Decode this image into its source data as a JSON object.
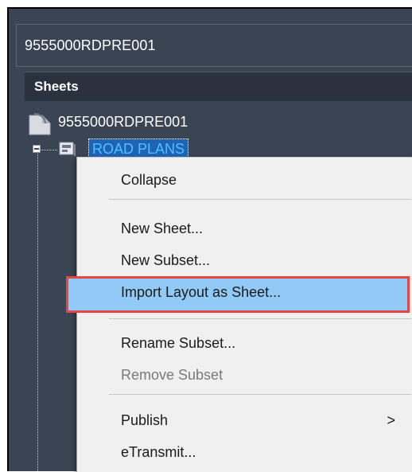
{
  "title_field": {
    "value": "9555000RDPRE001"
  },
  "panel": {
    "header": "Sheets"
  },
  "tree": {
    "root_label": "9555000RDPRE001",
    "subset_label": "ROAD PLANS"
  },
  "context_menu": {
    "items": [
      {
        "label": "Collapse",
        "enabled": true
      },
      {
        "label": "New Sheet...",
        "enabled": true
      },
      {
        "label": "New Subset...",
        "enabled": true
      },
      {
        "label": "Import Layout as Sheet...",
        "enabled": true,
        "highlighted": true
      },
      {
        "label": "Rename Subset...",
        "enabled": true
      },
      {
        "label": "Remove Subset",
        "enabled": false
      },
      {
        "label": "Publish",
        "enabled": true,
        "submenu_arrow": ">"
      },
      {
        "label": "eTransmit...",
        "enabled": true
      }
    ]
  },
  "colors": {
    "panel_bg": "#3b4453",
    "header_bg": "#2a3240",
    "selection_bg": "#1f63b5",
    "selection_text": "#4fc3ff",
    "menu_bg": "#f0f0f0",
    "highlight_bg": "#91c9f7",
    "highlight_border": "#e84545"
  }
}
